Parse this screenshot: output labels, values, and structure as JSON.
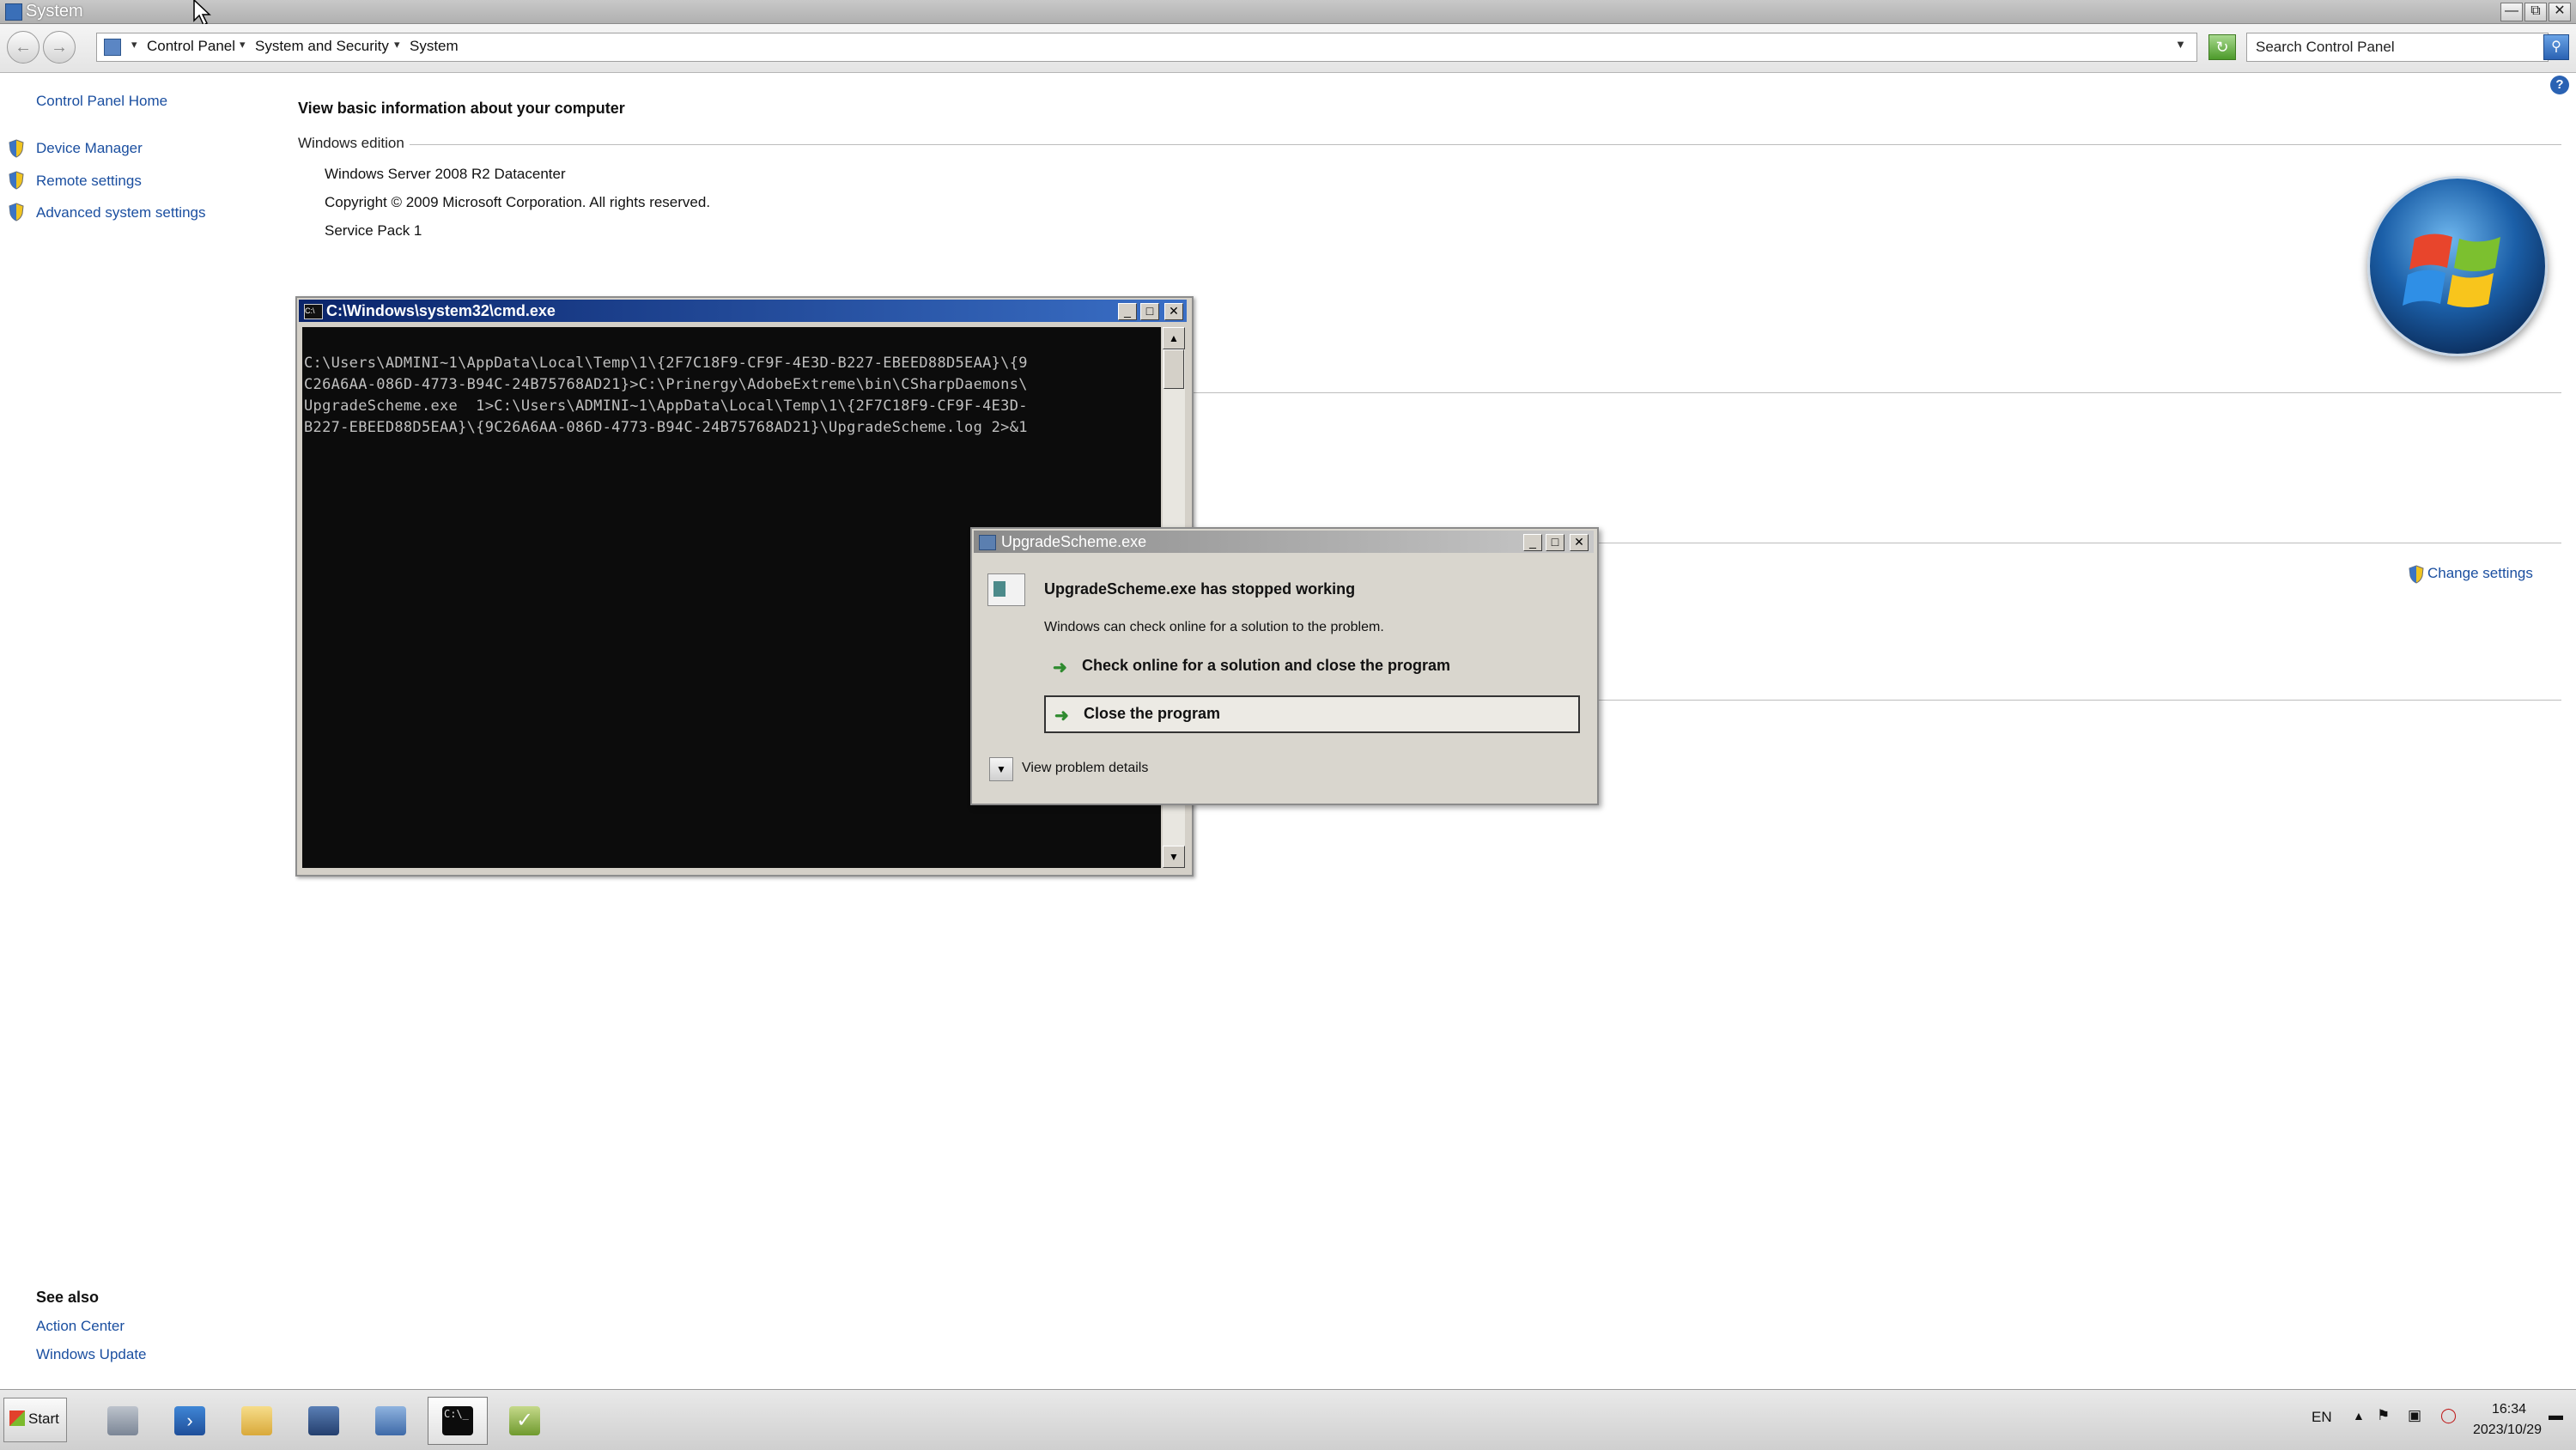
{
  "window": {
    "title": "System",
    "caption_buttons": [
      "minimize",
      "restore",
      "close"
    ]
  },
  "addressbar": {
    "back_icon": "back-arrow-icon",
    "forward_icon": "forward-arrow-icon",
    "breadcrumbs": [
      "Control Panel",
      "System and Security",
      "System"
    ],
    "search_placeholder": "Search Control Panel"
  },
  "sidebar": {
    "home": "Control Panel Home",
    "items": [
      {
        "label": "Device Manager",
        "icon": "shield-icon"
      },
      {
        "label": "Remote settings",
        "icon": "shield-icon"
      },
      {
        "label": "Advanced system settings",
        "icon": "shield-icon"
      }
    ],
    "see_also_title": "See also",
    "see_also": [
      "Action Center",
      "Windows Update"
    ]
  },
  "main": {
    "heading": "View basic information about your computer",
    "edition_section": "Windows edition",
    "edition_lines": [
      "Windows Server 2008 R2 Datacenter",
      "Copyright © 2009 Microsoft Corporation.  All rights reserved.",
      "Service Pack 1"
    ],
    "change_settings": "Change settings"
  },
  "cmd": {
    "title": "C:\\Windows\\system32\\cmd.exe",
    "lines": [
      "C:\\Users\\ADMINI~1\\AppData\\Local\\Temp\\1\\{2F7C18F9-CF9F-4E3D-B227-EBEED88D5EAA}\\{9",
      "C26A6AA-086D-4773-B94C-24B75768AD21}>C:\\Prinergy\\AdobeExtreme\\bin\\CSharpDaemons\\",
      "UpgradeScheme.exe  1>C:\\Users\\ADMINI~1\\AppData\\Local\\Temp\\1\\{2F7C18F9-CF9F-4E3D-",
      "B227-EBEED88D5EAA}\\{9C26A6AA-086D-4773-B94C-24B75768AD21}\\UpgradeScheme.log 2>&1"
    ]
  },
  "dialog": {
    "title": "UpgradeScheme.exe",
    "heading": "UpgradeScheme.exe has stopped working",
    "message": "Windows can check online for a solution to the problem.",
    "option1": "Check online for a solution and close the program",
    "option2": "Close the program",
    "details": "View problem details"
  },
  "taskbar": {
    "start_label": "Start",
    "apps": [
      "server-manager-icon",
      "powershell-icon",
      "explorer-folder-icon",
      "install-icon",
      "control-panel-icon",
      "cmd-icon",
      "setup-check-icon"
    ],
    "active_app": "cmd-icon",
    "language": "EN",
    "time": "16:34",
    "date": "2023/10/29"
  },
  "colors": {
    "link": "#1b4fa0",
    "cmd_background": "#0c0c0c",
    "cmd_text": "#c0c0c0",
    "cmd_title_active": "#0a246a",
    "option_arrow": "#2f8b2f"
  }
}
